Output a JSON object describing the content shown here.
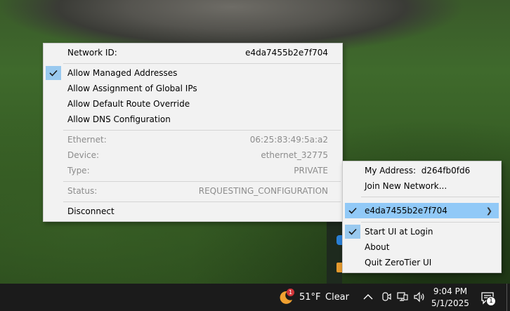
{
  "network_menu": {
    "network_id_label": "Network ID:",
    "network_id_value": "e4da7455b2e7f704",
    "options": [
      {
        "label": "Allow Managed Addresses",
        "checked": true
      },
      {
        "label": "Allow Assignment of Global IPs",
        "checked": false
      },
      {
        "label": "Allow Default Route Override",
        "checked": false
      },
      {
        "label": "Allow DNS Configuration",
        "checked": false
      }
    ],
    "info": [
      {
        "label": "Ethernet:",
        "value": "06:25:83:49:5a:a2"
      },
      {
        "label": "Device:",
        "value": "ethernet_32775"
      },
      {
        "label": "Type:",
        "value": "PRIVATE"
      }
    ],
    "status_label": "Status:",
    "status_value": "REQUESTING_CONFIGURATION",
    "disconnect_label": "Disconnect"
  },
  "tray_menu": {
    "my_address_label": "My Address:",
    "my_address_value": "d264fb0fd6",
    "join_label": "Join New Network...",
    "network_label": "e4da7455b2e7f704",
    "start_ui_label": "Start UI at Login",
    "start_ui_checked": true,
    "about_label": "About",
    "quit_label": "Quit ZeroTier UI"
  },
  "taskbar": {
    "temperature": "51°F",
    "condition": "Clear",
    "weather_badge": "1",
    "time": "9:04 PM",
    "date": "5/1/2025",
    "notification_count": "1"
  },
  "icons": {
    "weather": "moon-icon",
    "chevron": "chevron-up-icon",
    "meet": "meet-now-icon",
    "network": "network-icon",
    "volume": "speaker-icon",
    "notifications": "notification-icon"
  },
  "colors": {
    "menu_bg": "#f2f2f2",
    "highlight": "#91c9f7",
    "check_bg": "#99c9ef",
    "taskbar_bg": "#1b1b1b"
  }
}
